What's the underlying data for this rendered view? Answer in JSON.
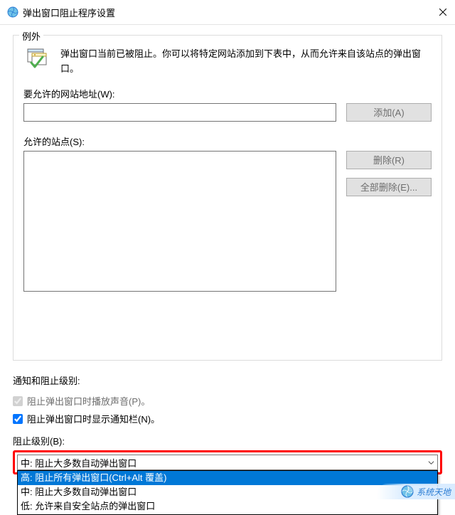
{
  "titlebar": {
    "title": "弹出窗口阻止程序设置"
  },
  "exceptions": {
    "legend": "例外",
    "intro": "弹出窗口当前已被阻止。你可以将特定网站添加到下表中，从而允许来自该站点的弹出窗口。",
    "address_label": "要允许的网站地址(W):",
    "address_value": "",
    "add_label": "添加(A)",
    "allowed_label": "允许的站点(S):",
    "delete_label": "删除(R)",
    "delete_all_label": "全部删除(E)..."
  },
  "settings": {
    "section_label": "通知和阻止级别:",
    "play_sound_label": "阻止弹出窗口时播放声音(P)。",
    "show_infobar_label": "阻止弹出窗口时显示通知栏(N)。",
    "blocking_level_label": "阻止级别(B):",
    "selected": "中: 阻止大多数自动弹出窗口",
    "options": [
      "高: 阻止所有弹出窗口(Ctrl+Alt 覆盖)",
      "中: 阻止大多数自动弹出窗口",
      "低: 允许来自安全站点的弹出窗口"
    ]
  },
  "accent_color": "#0078d7",
  "watermark": "系统天地"
}
